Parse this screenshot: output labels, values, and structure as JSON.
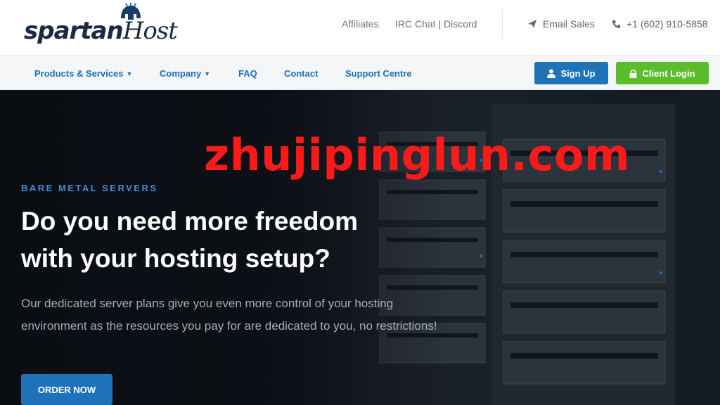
{
  "brand": {
    "logo_part1": "spartan",
    "logo_part2": "Host"
  },
  "top_links": {
    "affiliates": "Affiliates",
    "irc": "IRC Chat | Discord"
  },
  "contact": {
    "email_sales": "Email Sales",
    "phone": "+1 (602) 910-5858"
  },
  "nav": {
    "products": "Products & Services",
    "company": "Company",
    "faq": "FAQ",
    "contact": "Contact",
    "support": "Support Centre",
    "signup": "Sign Up",
    "login": "Client Login"
  },
  "hero": {
    "watermark": "zhujipinglun.com",
    "eyebrow": "BARE METAL SERVERS",
    "headline_line1": "Do you need more freedom",
    "headline_line2": "with your hosting setup?",
    "description": "Our dedicated server plans give you even more control of your hosting environment as the resources you pay for are dedicated to you, no restrictions!",
    "cta": "ORDER NOW"
  },
  "colors": {
    "brand_blue": "#1d72b8",
    "login_green": "#5bbd2b",
    "nav_link": "#1e6fb3",
    "watermark_red": "#ff1a1a"
  },
  "icons": {
    "email": "paper-plane-icon",
    "phone": "phone-icon",
    "signup": "user-icon",
    "login": "lock-icon",
    "dropdown": "chevron-down-icon"
  }
}
